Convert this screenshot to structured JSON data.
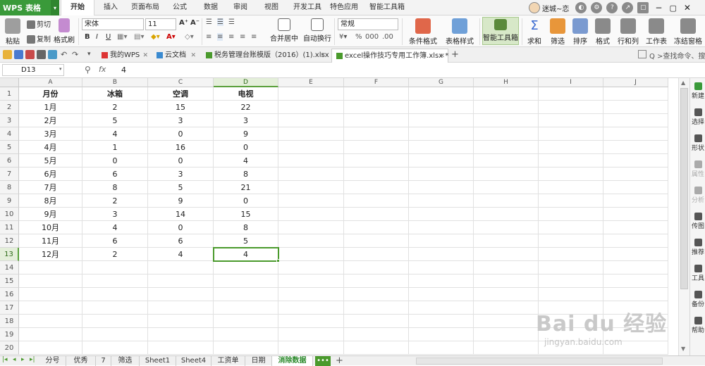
{
  "app": {
    "logo": "WPS 表格",
    "logo_drop": "▾"
  },
  "menu_tabs": [
    "开始",
    "插入",
    "页面布局",
    "公式",
    "数据",
    "审阅",
    "视图",
    "开发工具",
    "特色应用",
    "智能工具箱"
  ],
  "user": {
    "name": "迷城~恋"
  },
  "ribbon": {
    "paste": "粘贴",
    "cut": "剪切",
    "copy": "复制",
    "format_painter": "格式刷",
    "font_name": "宋体",
    "font_size": "11",
    "bold": "B",
    "italic": "I",
    "underline": "U",
    "grow_font": "A⁺",
    "shrink_font": "A⁻",
    "merge_center": "合并居中",
    "wrap_text": "自动换行",
    "number_format": "常规",
    "percent": "%",
    "conditional_format": "条件格式",
    "table_style": "表格样式",
    "smart_toolbox": "智能工具箱",
    "sum": "求和",
    "filter": "筛选",
    "sort": "排序",
    "format": "格式",
    "rows_cols": "行和列",
    "worksheet": "工作表",
    "freeze": "冻结窗格"
  },
  "doc_tabs": [
    "我的WPS",
    "云文档",
    "税务管理台账模版（2016）(1).xlsx",
    "excel操作技巧专用工作簿.xlsx *"
  ],
  "search": {
    "placeholder": "Q >查找命令、搜索..."
  },
  "formula_bar": {
    "cell_ref": "D13",
    "fx": "fx",
    "value": "4"
  },
  "columns": [
    "A",
    "B",
    "C",
    "D",
    "E",
    "F",
    "G",
    "H",
    "I",
    "J"
  ],
  "rows": [
    "1",
    "2",
    "3",
    "4",
    "5",
    "6",
    "7",
    "8",
    "9",
    "10",
    "11",
    "12",
    "13",
    "14",
    "15",
    "16",
    "17",
    "18",
    "19",
    "20"
  ],
  "table": {
    "headers": [
      "月份",
      "冰箱",
      "空调",
      "电视"
    ],
    "rows": [
      [
        "1月",
        "2",
        "15",
        "22"
      ],
      [
        "2月",
        "5",
        "3",
        "3"
      ],
      [
        "3月",
        "4",
        "0",
        "9"
      ],
      [
        "4月",
        "1",
        "16",
        "0"
      ],
      [
        "5月",
        "0",
        "0",
        "4"
      ],
      [
        "6月",
        "6",
        "3",
        "8"
      ],
      [
        "7月",
        "8",
        "5",
        "21"
      ],
      [
        "8月",
        "2",
        "9",
        "0"
      ],
      [
        "9月",
        "3",
        "14",
        "15"
      ],
      [
        "10月",
        "4",
        "0",
        "8"
      ],
      [
        "11月",
        "6",
        "6",
        "5"
      ],
      [
        "12月",
        "2",
        "4",
        "4"
      ]
    ]
  },
  "side_panel": [
    "新建",
    "选择",
    "形状",
    "属性",
    "分析",
    "传图",
    "推荐",
    "工具",
    "备份",
    "帮助"
  ],
  "sheet_tabs": [
    "分号",
    "优秀",
    "7",
    "筛选",
    "Sheet1",
    "Sheet4",
    "工资单",
    "日期",
    "消除数据"
  ],
  "sheet_more": "•••",
  "sheet_add": "+",
  "watermark": {
    "brand": "Bai du 经验",
    "url": "jingyan.baidu.com"
  },
  "colors": {
    "accent": "#3a9a3a",
    "selection": "#4a9a2c"
  }
}
